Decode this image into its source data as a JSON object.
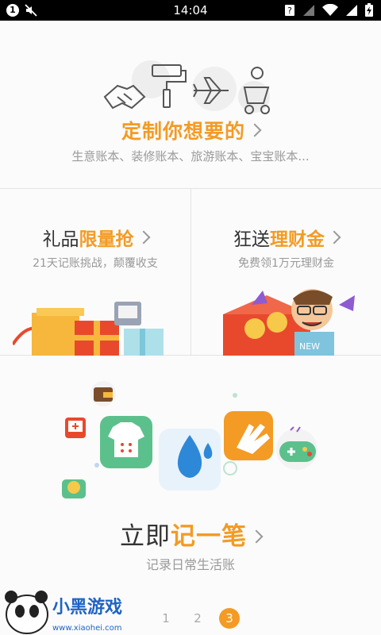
{
  "status_bar": {
    "time": "14:04",
    "notification_count": "1"
  },
  "custom_books": {
    "title": "定制你想要的",
    "subtitle": "生意账本、装修账本、旅游账本、宝宝账本..."
  },
  "gift_promo": {
    "title_prefix": "礼品",
    "title_highlight": "限量抢",
    "subtitle": "21天记账挑战，颠覆收支"
  },
  "cash_promo": {
    "title_prefix": "狂送",
    "title_highlight": "理财金",
    "subtitle": "免费领1万元理财金",
    "badge": "NEW"
  },
  "record": {
    "title_prefix": "立即",
    "title_highlight": "记一笔",
    "subtitle": "记录日常生活账"
  },
  "pager": {
    "pages": [
      "1",
      "2",
      "3"
    ],
    "active_index": 2
  },
  "watermark": {
    "brand": "小黑游戏",
    "url": "www.xiaohei.com"
  },
  "colors": {
    "accent": "#f39b25",
    "status_bar": "#000000",
    "background": "#fafafa"
  }
}
